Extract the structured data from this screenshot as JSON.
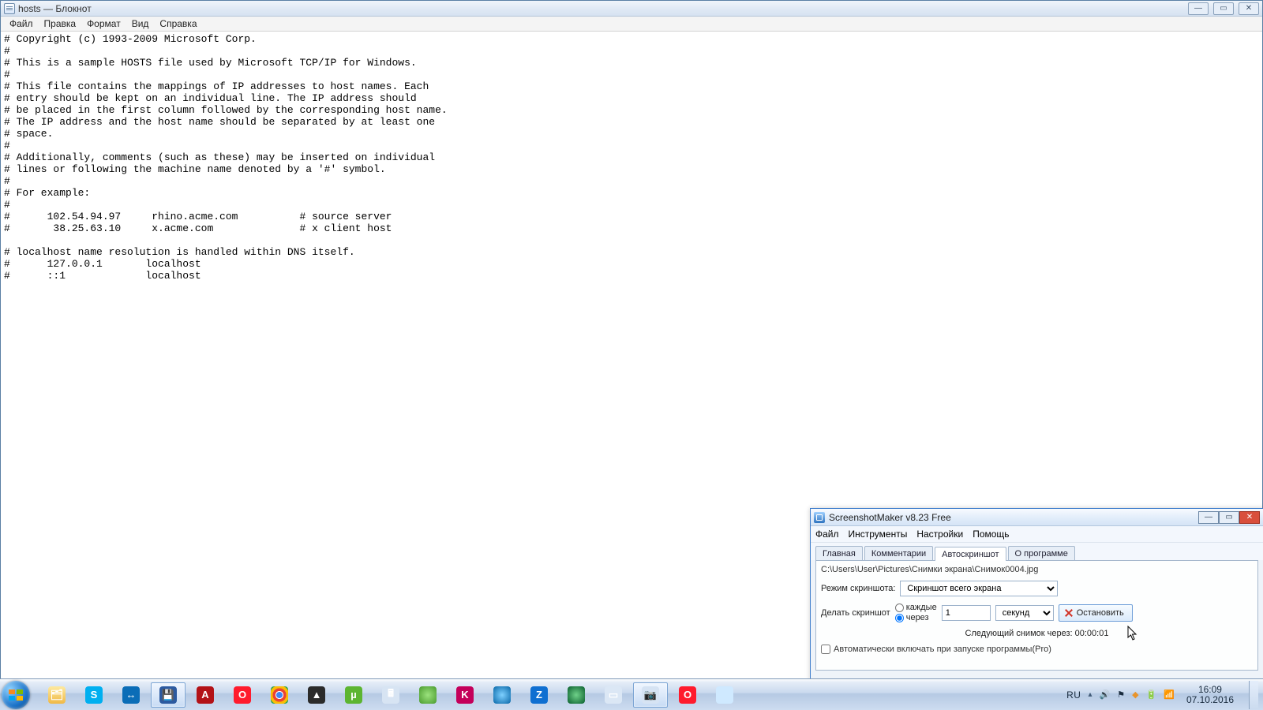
{
  "notepad": {
    "title": "hosts — Блокнот",
    "menus": [
      "Файл",
      "Правка",
      "Формат",
      "Вид",
      "Справка"
    ],
    "content": "# Copyright (c) 1993-2009 Microsoft Corp.\n#\n# This is a sample HOSTS file used by Microsoft TCP/IP for Windows.\n#\n# This file contains the mappings of IP addresses to host names. Each\n# entry should be kept on an individual line. The IP address should\n# be placed in the first column followed by the corresponding host name.\n# The IP address and the host name should be separated by at least one\n# space.\n#\n# Additionally, comments (such as these) may be inserted on individual\n# lines or following the machine name denoted by a '#' symbol.\n#\n# For example:\n#\n#      102.54.94.97     rhino.acme.com          # source server\n#       38.25.63.10     x.acme.com              # x client host\n\n# localhost name resolution is handled within DNS itself.\n#      127.0.0.1       localhost\n#      ::1             localhost"
  },
  "screenshotmaker": {
    "title": "ScreenshotMaker v8.23 Free",
    "menus": [
      "Файл",
      "Инструменты",
      "Настройки",
      "Помощь"
    ],
    "tabs": [
      "Главная",
      "Комментарии",
      "Автоскриншот",
      "О программе"
    ],
    "active_tab": 2,
    "path": "C:\\Users\\User\\Pictures\\Снимки экрана\\Снимок0004.jpg",
    "mode_label": "Режим скриншота:",
    "mode_value": "Скриншот всего экрана",
    "make_label": "Делать скриншот",
    "radio_every": "каждые",
    "radio_after": "через",
    "interval_value": "1",
    "unit_value": "секунд",
    "stop_label": "Остановить",
    "next_label": "Следующий снимок через: 00:00:01",
    "autostart_label": "Автоматически включать при запуске программы(Pro)"
  },
  "taskbar": {
    "icons": [
      {
        "name": "explorer",
        "bg": "linear-gradient(#fde9a0,#f0b946)",
        "glyph": "🗂"
      },
      {
        "name": "skype",
        "bg": "#00aff0",
        "glyph": "S"
      },
      {
        "name": "teamviewer",
        "bg": "#0b6db7",
        "glyph": "↔"
      },
      {
        "name": "notepad",
        "bg": "#2c5aa0",
        "glyph": "💾",
        "active": true
      },
      {
        "name": "adobe-reader",
        "bg": "#b31217",
        "glyph": "A"
      },
      {
        "name": "opera",
        "bg": "#ff1b2d",
        "glyph": "O"
      },
      {
        "name": "chrome",
        "bg": "radial-gradient(circle,#4285f4 25%,#fff 26% 32%,#ea4335 33% 55%,#fbbc05 56% 78%,#34a853 79%)",
        "glyph": ""
      },
      {
        "name": "aimp",
        "bg": "#2b2b2b",
        "glyph": "▲"
      },
      {
        "name": "utorrent",
        "bg": "#5cb531",
        "glyph": "µ"
      },
      {
        "name": "calculator",
        "bg": "#d7e4f3",
        "glyph": "🖩"
      },
      {
        "name": "circle",
        "bg": "radial-gradient(circle,#9be27d,#4a9b2e)",
        "glyph": ""
      },
      {
        "name": "app-k",
        "bg": "#c4005a",
        "glyph": "K"
      },
      {
        "name": "globe1",
        "bg": "radial-gradient(circle,#7ed0ff,#0968a9)",
        "glyph": ""
      },
      {
        "name": "zona",
        "bg": "#0f6fd1",
        "glyph": "Z"
      },
      {
        "name": "globe2",
        "bg": "radial-gradient(circle,#6fd189,#0a5f2e)",
        "glyph": ""
      },
      {
        "name": "window",
        "bg": "#dbe7f5",
        "glyph": "▭"
      },
      {
        "name": "screenshotmaker",
        "bg": "#d6e3f3",
        "glyph": "📷",
        "active": true
      },
      {
        "name": "opera2",
        "bg": "#ff1b2d",
        "glyph": "O"
      },
      {
        "name": "blank-app",
        "bg": "#cfe9ff",
        "glyph": ""
      }
    ],
    "lang": "RU",
    "time": "16:09",
    "date": "07.10.2016"
  }
}
